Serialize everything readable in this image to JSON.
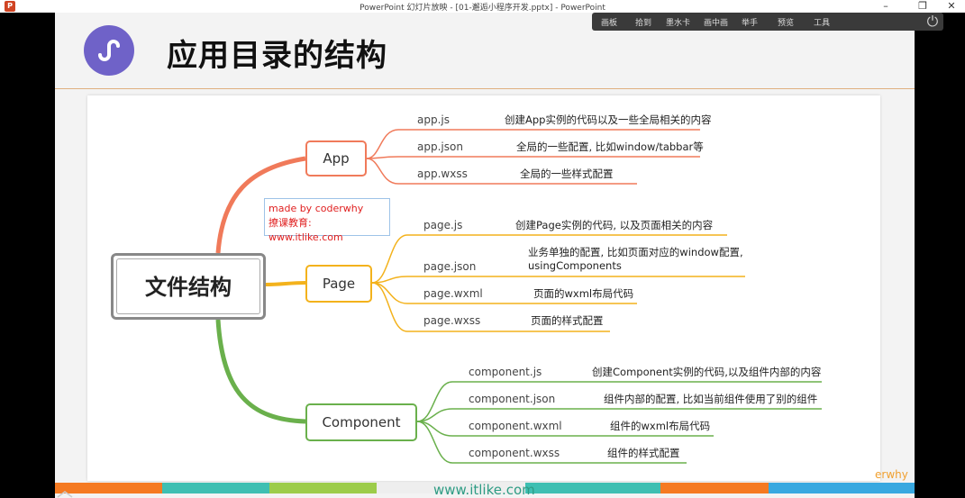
{
  "window": {
    "title": "PowerPoint 幻灯片放映 - [01-邂逅小程序开发.pptx] - PowerPoint",
    "app_logo": "P",
    "minimize": "–",
    "restore": "❐",
    "close": "✕"
  },
  "toolbar": {
    "items": [
      "画板",
      "拾到",
      "墨水卡",
      "画中画",
      "举手",
      "预览",
      "工具"
    ]
  },
  "slide": {
    "title": "应用目录的结构",
    "root": "文件结构",
    "watermark": {
      "line1": "made by coderwhy",
      "line2": "撩课教育: www.itlike.com"
    },
    "branches": [
      {
        "label": "App",
        "color": "#f07a5a",
        "items": [
          {
            "name": "app.js",
            "desc": "创建App实例的代码以及一些全局相关的内容"
          },
          {
            "name": "app.json",
            "desc": "全局的一些配置, 比如window/tabbar等"
          },
          {
            "name": "app.wxss",
            "desc": "全局的一些样式配置"
          }
        ]
      },
      {
        "label": "Page",
        "color": "#f3b21c",
        "items": [
          {
            "name": "page.js",
            "desc": "创建Page实例的代码, 以及页面相关的内容"
          },
          {
            "name": "page.json",
            "desc": "业务单独的配置, 比如页面对应的window配置,",
            "desc2": "usingComponents"
          },
          {
            "name": "page.wxml",
            "desc": "页面的wxml布局代码"
          },
          {
            "name": "page.wxss",
            "desc": "页面的样式配置"
          }
        ]
      },
      {
        "label": "Component",
        "color": "#6ab04c",
        "items": [
          {
            "name": "component.js",
            "desc": "创建Component实例的代码,以及组件内部的内容"
          },
          {
            "name": "component.json",
            "desc": "组件内部的配置, 比如当前组件使用了别的组件"
          },
          {
            "name": "component.wxml",
            "desc": "组件的wxml布局代码"
          },
          {
            "name": "component.wxss",
            "desc": "组件的样式配置"
          }
        ]
      }
    ],
    "footer_url": "www.itlike.com",
    "corner_text": "erwhy",
    "stripe_colors": [
      "#f57a22",
      "#3ebfb2",
      "#9ccc4a",
      "#eeeeee",
      "#3ebfb2",
      "#f57a22",
      "#38a8e0"
    ]
  }
}
